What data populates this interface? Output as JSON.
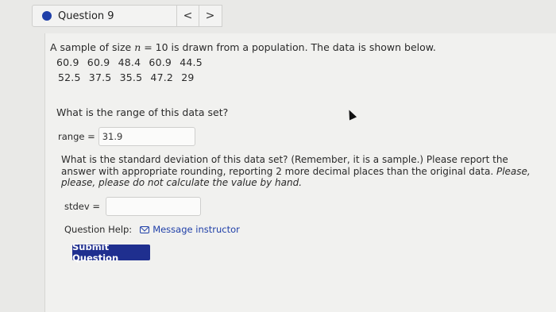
{
  "header": {
    "question_title": "Question 9",
    "dropdown_glyph": "▼",
    "prev_glyph": "<",
    "next_glyph": ">"
  },
  "question": {
    "intro_prefix": "A sample of size ",
    "intro_var": "n",
    "intro_suffix": " = 10 is drawn from a population. The data is shown below.",
    "data_row_1": "60.9 60.9 48.4 60.9 44.5",
    "data_row_2": "52.5 37.5 35.5 47.2 29",
    "range_question": "What is the range of this data set?",
    "range_label": "range =",
    "range_value": "31.9",
    "stdev_question_main": "What is the standard deviation of this data set? (Remember, it is a sample.) Please report the answer with appropriate rounding, reporting 2 more decimal places than the original data. ",
    "stdev_question_italic": "Please, please, please do not calculate the value by hand.",
    "stdev_label": "stdev =",
    "stdev_value": ""
  },
  "help": {
    "label": "Question Help:",
    "message_link": "Message instructor"
  },
  "submit_label": "Submit Question",
  "colors": {
    "accent": "#1f3fa8",
    "submit_bg": "#1f2f8f"
  }
}
